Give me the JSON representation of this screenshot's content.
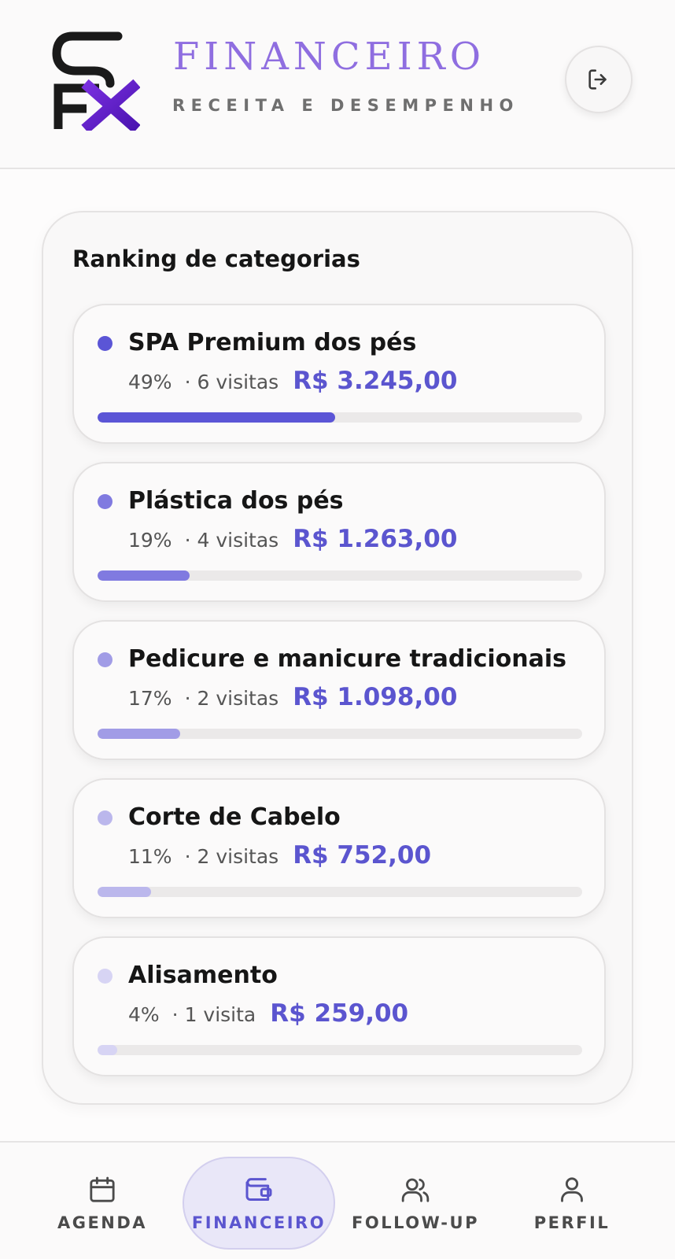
{
  "header": {
    "title": "FINANCEIRO",
    "subtitle": "RECEITA E DESEMPENHO",
    "logout_icon": "logout-icon",
    "logo_icon": "sfx-logo"
  },
  "ranking": {
    "title": "Ranking de categorias",
    "items": [
      {
        "name": "SPA Premium dos pés",
        "percent": "49%",
        "visits": "· 6 visitas",
        "amount": "R$ 3.245,00",
        "share": 0.49,
        "color": "#5b55d6"
      },
      {
        "name": "Plástica dos pés",
        "percent": "19%",
        "visits": "· 4 visitas",
        "amount": "R$ 1.263,00",
        "share": 0.19,
        "color": "#807ae0"
      },
      {
        "name": "Pedicure e manicure tradicionais",
        "percent": "17%",
        "visits": "· 2 visitas",
        "amount": "R$ 1.098,00",
        "share": 0.17,
        "color": "#a19ce6"
      },
      {
        "name": "Corte de Cabelo",
        "percent": "11%",
        "visits": "· 2 visitas",
        "amount": "R$ 752,00",
        "share": 0.11,
        "color": "#bbb7ec"
      },
      {
        "name": "Alisamento",
        "percent": "4%",
        "visits": "· 1 visita",
        "amount": "R$ 259,00",
        "share": 0.04,
        "color": "#d7d4f4"
      }
    ]
  },
  "nav": {
    "items": [
      {
        "label": "AGENDA",
        "icon": "calendar-icon",
        "active": false
      },
      {
        "label": "FINANCEIRO",
        "icon": "wallet-icon",
        "active": true
      },
      {
        "label": "FOLLOW-UP",
        "icon": "users-icon",
        "active": false
      },
      {
        "label": "PERFIL",
        "icon": "user-icon",
        "active": false
      }
    ]
  },
  "colors": {
    "accent": "#5b55cf",
    "title": "#8f6ee0"
  }
}
